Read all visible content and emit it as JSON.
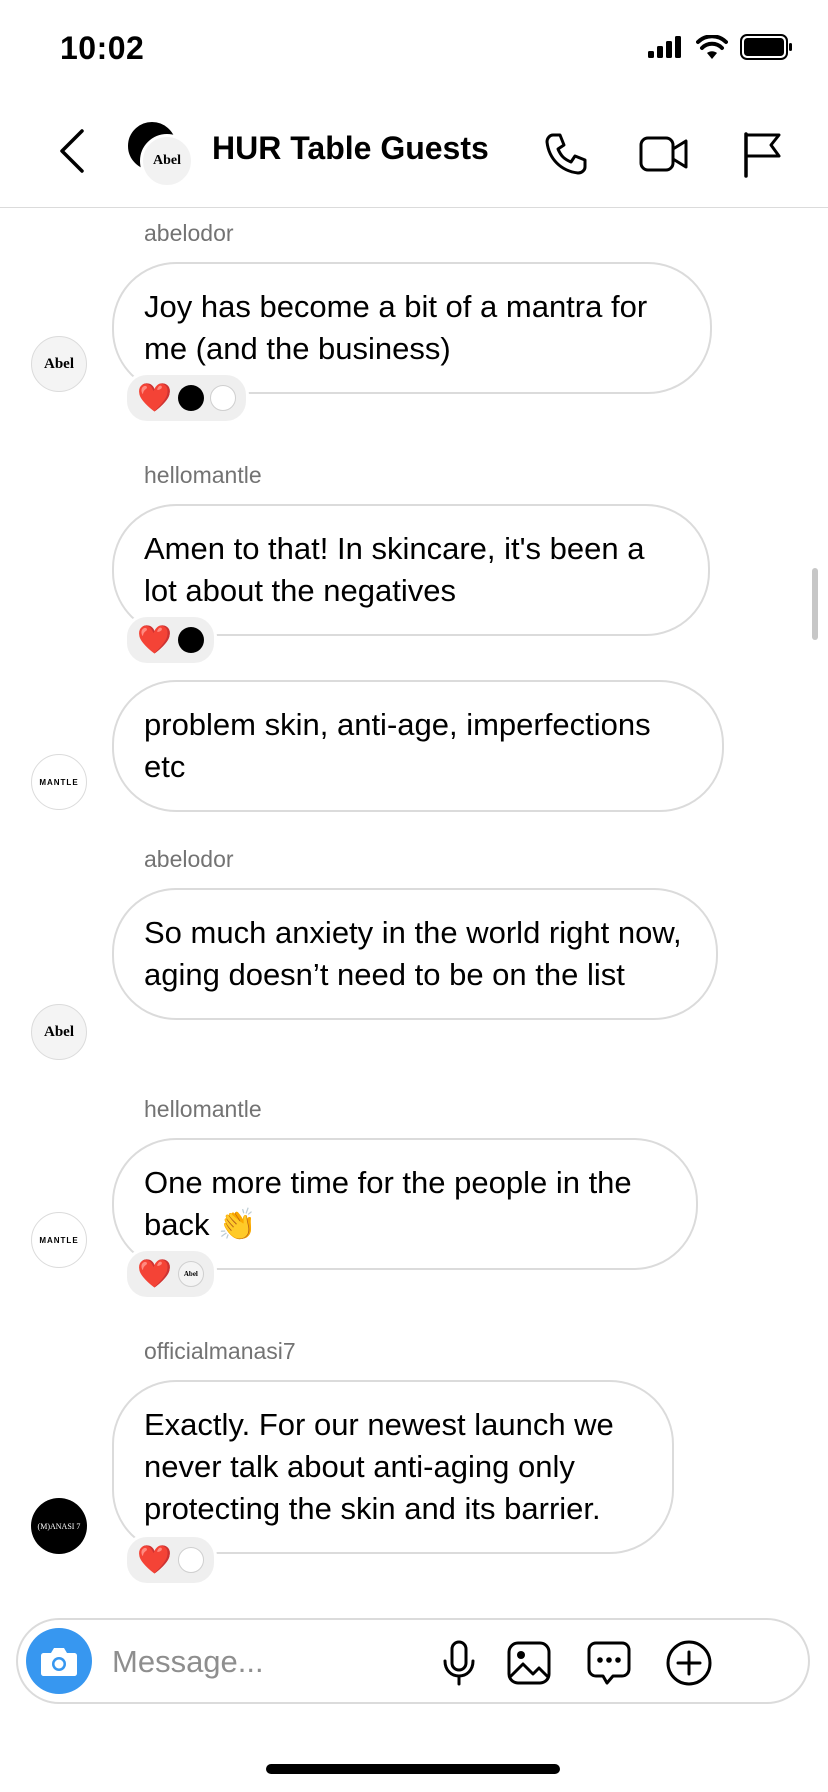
{
  "status_bar": {
    "time": "10:02"
  },
  "header": {
    "title": "HUR Table Guests",
    "avatar_front_text": "Abel"
  },
  "messages": [
    {
      "sender": "abelodor",
      "text": "Joy has become a bit of a mantra for me (and the business)",
      "avatar_text": "Abel"
    },
    {
      "sender": "hellomantle",
      "text": "Amen to that! In skincare, it's been a lot about the negatives"
    },
    {
      "text": "problem skin, anti-age, imperfections etc",
      "avatar_text": "MANTLE"
    },
    {
      "sender": "abelodor",
      "text": "So much anxiety in the world right now, aging doesn’t need to be on the list",
      "avatar_text": "Abel"
    },
    {
      "sender": "hellomantle",
      "text": "One more time for the people in the back 👏",
      "avatar_text": "MANTLE"
    },
    {
      "sender": "officialmanasi7",
      "text": "Exactly. For our newest launch we never talk about anti-aging only protecting the skin and its barrier.",
      "avatar_text": "(M)ANASI 7"
    }
  ],
  "reactions": {
    "heart": "❤️",
    "mini_abel": "Abel",
    "mini_mantle": "MANTLE"
  },
  "composer": {
    "placeholder": "Message..."
  },
  "icons": {
    "back": "chevron-left-icon",
    "call": "phone-icon",
    "video": "video-camera-icon",
    "report": "flag-icon",
    "camera": "camera-icon",
    "mic": "microphone-icon",
    "gallery": "image-icon",
    "sticker": "chat-bubble-icon",
    "more": "plus-circle-icon"
  },
  "colors": {
    "accent": "#3797f0",
    "heart": "#ed2a3c",
    "border": "#dbdbdb",
    "muted": "#737373"
  }
}
